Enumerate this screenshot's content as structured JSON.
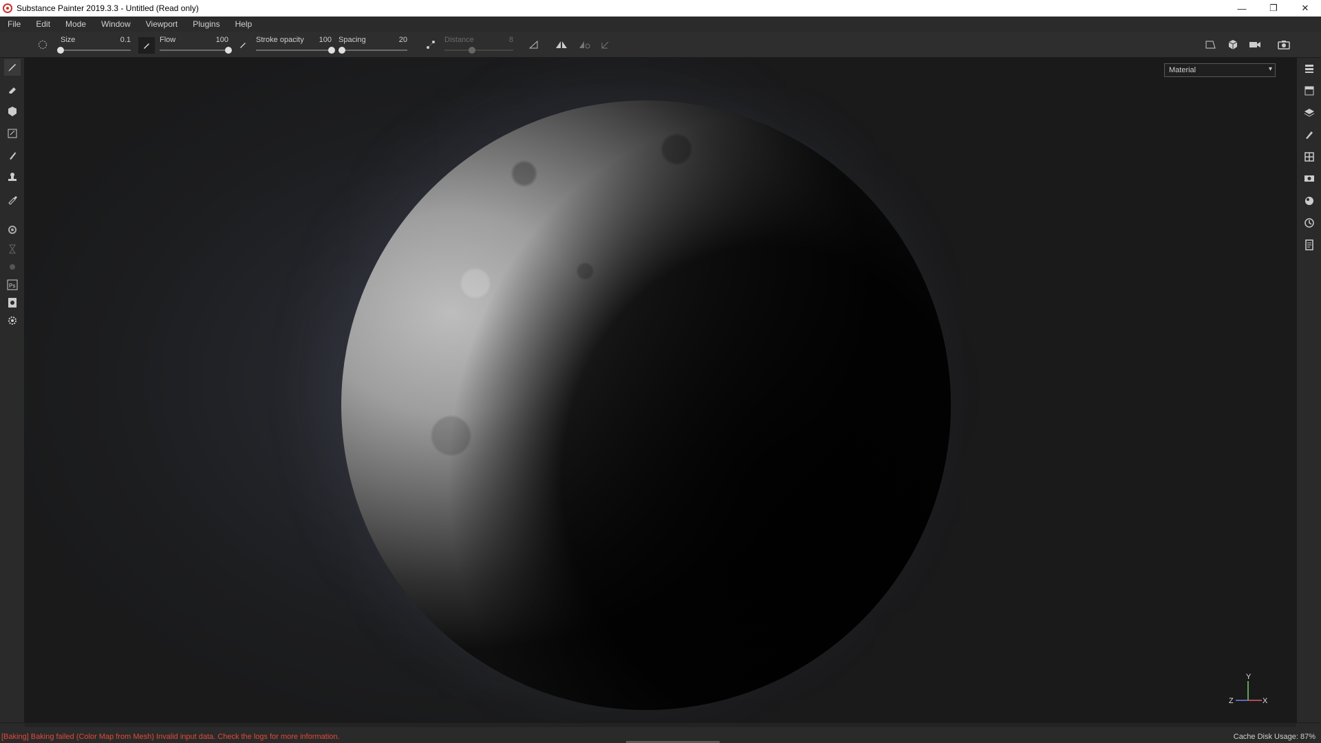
{
  "window": {
    "title": "Substance Painter 2019.3.3 - Untitled (Read only)",
    "controls": {
      "minimize": "—",
      "restore": "❐",
      "close": "✕"
    }
  },
  "menu": {
    "items": [
      "File",
      "Edit",
      "Mode",
      "Window",
      "Viewport",
      "Plugins",
      "Help"
    ]
  },
  "tool_options": {
    "size": {
      "label": "Size",
      "value": "0.1",
      "fraction": 0.0
    },
    "flow": {
      "label": "Flow",
      "value": "100",
      "fraction": 1.0
    },
    "stroke_opacity": {
      "label": "Stroke opacity",
      "value": "100",
      "fraction": 1.0
    },
    "spacing": {
      "label": "Spacing",
      "value": "20",
      "fraction": 0.05
    },
    "distance": {
      "label": "Distance",
      "value": "8",
      "fraction": 0.4,
      "disabled": true
    }
  },
  "icons": {
    "brush_shape": "brush-shape-icon",
    "pressure": "pen-pressure-icon",
    "lazy_mouse": "lazy-mouse-icon",
    "symmetry": "symmetry-icon",
    "mirror": "mirror-icon",
    "camera_views": [
      "viewport-2d-icon",
      "viewport-3d-icon",
      "camera-icon",
      "screenshot-icon"
    ]
  },
  "left_tools": [
    "paint-brush-icon",
    "eraser-icon",
    "projection-icon",
    "polygon-fill-icon",
    "smudge-icon",
    "clone-stamp-icon",
    "color-picker-icon",
    "bake-settings-icon",
    "physics-icon",
    "particle-icon",
    "photoshop-export-icon",
    "export-textures-icon",
    "settings-icon"
  ],
  "right_tools": [
    "layers-panel-icon",
    "texture-set-icon",
    "layer-stack-icon",
    "properties-icon",
    "uv-grid-icon",
    "display-settings-icon",
    "shader-settings-icon",
    "history-icon",
    "log-icon"
  ],
  "viewport": {
    "channel_select": "Material",
    "axis": {
      "y": "Y",
      "z": "Z",
      "x": "X"
    }
  },
  "status": {
    "message": "[Baking] Baking failed (Color Map from Mesh) Invalid input data. Check the logs for more information.",
    "cache_label": "Cache Disk Usage:",
    "cache_value": "87%"
  }
}
